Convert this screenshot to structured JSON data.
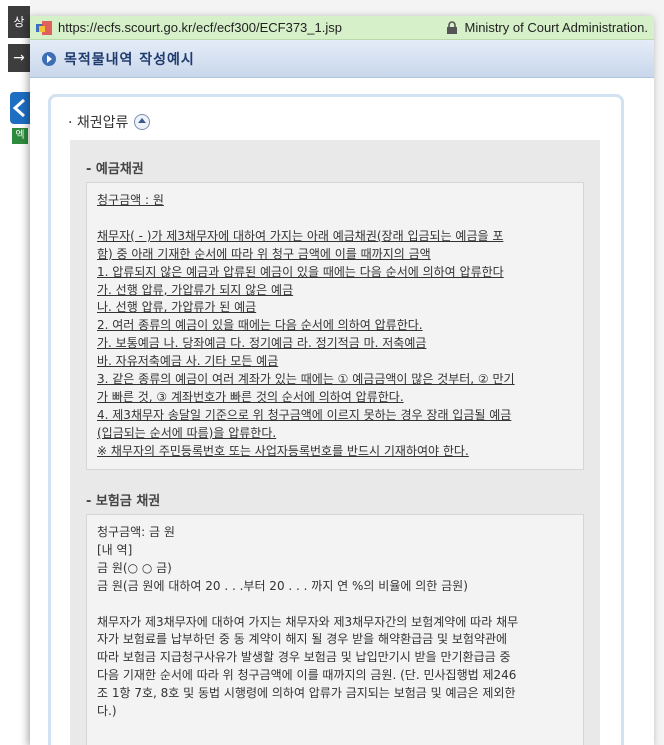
{
  "background": {
    "tab1_char": "상",
    "tab2_char": "→",
    "excel_char": "엑"
  },
  "popup": {
    "url": "https://ecfs.scourt.go.kr/ecf/ecf300/ECF373_1.jsp",
    "org": "Ministry of Court Administration.",
    "title": "목적물내역 작성예시"
  },
  "section": {
    "title": "· 채권압류",
    "deposit": {
      "heading": "- 예금채권",
      "lines": [
        "청구금액 : 원",
        "",
        "채무자( - )가 제3채무자에 대하여 가지는 아래 예금채권(장래 입금되는 예금을 포",
        "함) 중 아래 기재한 순서에 따라 위 청구 금액에 이를 때까지의 금액",
        "1. 압류되지 않은 예금과 압류된 예금이 있을 때에는 다음 순서에 의하여 압류한다",
        "가. 선행 압류, 가압류가 되지 않은 예금",
        "나. 선행 압류, 가압류가 된 예금",
        "2. 여러 종류의 예금이 있을 때에는 다음 순서에 의하여 압류한다.",
        "가. 보통예금 나. 당좌예금 다. 정기예금 라. 정기적금 마. 저축예금",
        "바. 자유저축예금 사. 기타 모든 예금",
        "3. 같은 종류의 예금이 여러 계좌가 있는 때에는 ① 예금금액이 많은 것부터, ② 만기",
        "가 빠른 것, ③ 계좌번호가 빠른 것의 순서에 의하여 압류한다.",
        "4. 제3채무자 송달일 기준으로 위 청구금액에 이르지 못하는 경우 장래 입금될 예금",
        "(입금되는 순서에 따름)을 압류한다.",
        "※ 채무자의 주민등록번호 또는 사업자등록번호를 반드시 기재하여야 한다."
      ]
    },
    "insurance": {
      "heading": "- 보험금 채권",
      "lines": [
        "청구금액: 금 원",
        "[내 역]",
        "금 원(○ ○ 금)",
        "금 원(금 원에 대하여 20 . . .부터 20 . . . 까지 연 %의 비율에 의한 금원)",
        "",
        "채무자가 제3채무자에 대하여 가지는 채무자와 제3채무자간의 보험계약에 따라 채무",
        "자가 보험료를 납부하던 중 동 계약이 해지 될 경우 받을 해약환급금 및 보험약관에",
        "따라 보험금 지급청구사유가 발생할 경우 보험금 및 납입만기시 받을 만기환급금 중",
        "다음 기재한 순서에 따라 위 청구금액에 이를 때까지의 금원. (단. 민사집행법 제246",
        "조 1항 7호, 8호 및 동법 시행령에 의하여 압류가 금지되는 보험금 및 예금은 제외한",
        "다.)"
      ]
    }
  }
}
